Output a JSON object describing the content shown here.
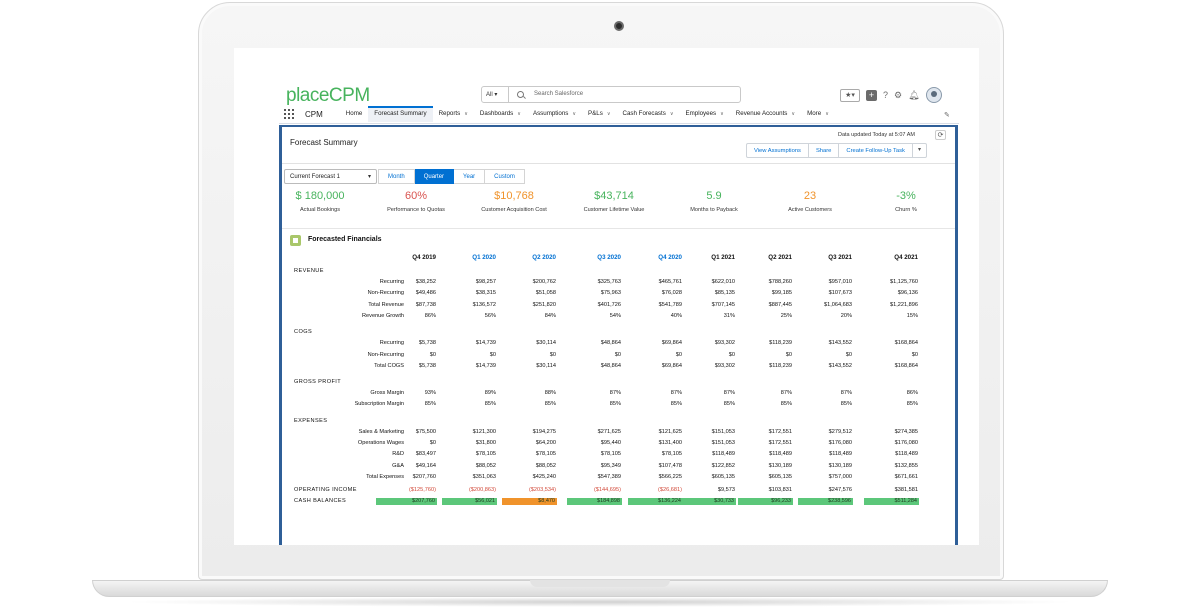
{
  "logo": {
    "text_main": "place",
    "text_suffix": "CPM"
  },
  "search": {
    "scope": "All",
    "placeholder": "Search Salesforce"
  },
  "nav": {
    "app_name": "CPM",
    "items": [
      {
        "label": "Home",
        "dropdown": false
      },
      {
        "label": "Forecast Summary",
        "dropdown": false,
        "active": true
      },
      {
        "label": "Reports",
        "dropdown": true
      },
      {
        "label": "Dashboards",
        "dropdown": true
      },
      {
        "label": "Assumptions",
        "dropdown": true
      },
      {
        "label": "P&Ls",
        "dropdown": true
      },
      {
        "label": "Cash Forecasts",
        "dropdown": true
      },
      {
        "label": "Employees",
        "dropdown": true
      },
      {
        "label": "Revenue Accounts",
        "dropdown": true
      },
      {
        "label": "More",
        "dropdown": true
      }
    ]
  },
  "page": {
    "title": "Forecast Summary",
    "updated": "Data updated Today at 5:07 AM",
    "buttons": [
      "View Assumptions",
      "Share",
      "Create Follow-Up Task"
    ]
  },
  "controls": {
    "forecast_select": "Current Forecast 1",
    "periods": [
      "Month",
      "Quarter",
      "Year",
      "Custom"
    ],
    "active_period": "Quarter"
  },
  "kpis": [
    {
      "value": "$ 180,000",
      "label": "Actual Bookings",
      "color": "#47b35d"
    },
    {
      "value": "60%",
      "label": "Performance to Quotas",
      "color": "#d9534f"
    },
    {
      "value": "$10,768",
      "label": "Customer Acquisition Cost",
      "color": "#f0932b"
    },
    {
      "value": "$43,714",
      "label": "Customer Lifetime Value",
      "color": "#47b35d"
    },
    {
      "value": "5.9",
      "label": "Months to Payback",
      "color": "#47b35d"
    },
    {
      "value": "23",
      "label": "Active Customers",
      "color": "#f0932b"
    },
    {
      "value": "-3%",
      "label": "Churn %",
      "color": "#47b35d"
    }
  ],
  "financials": {
    "title": "Forecasted Financials",
    "quarters": [
      {
        "label": "Q4 2019",
        "color": "#111111"
      },
      {
        "label": "Q1 2020",
        "color": "#0070d2"
      },
      {
        "label": "Q2 2020",
        "color": "#0070d2"
      },
      {
        "label": "Q3 2020",
        "color": "#0070d2"
      },
      {
        "label": "Q4 2020",
        "color": "#0070d2"
      },
      {
        "label": "Q1 2021",
        "color": "#111111"
      },
      {
        "label": "Q2 2021",
        "color": "#111111"
      },
      {
        "label": "Q3 2021",
        "color": "#111111"
      },
      {
        "label": "Q4 2021",
        "color": "#111111"
      }
    ],
    "sections": [
      {
        "name": "REVENUE",
        "rows": [
          {
            "label": "Recurring",
            "values": [
              "$38,252",
              "$98,257",
              "$200,762",
              "$325,763",
              "$465,761",
              "$622,010",
              "$788,260",
              "$957,010",
              "$1,125,760"
            ]
          },
          {
            "label": "Non-Recurring",
            "values": [
              "$49,486",
              "$38,315",
              "$51,058",
              "$75,963",
              "$76,028",
              "$85,135",
              "$99,185",
              "$107,673",
              "$96,136"
            ]
          },
          {
            "label": "Total Revenue",
            "values": [
              "$87,738",
              "$136,572",
              "$251,820",
              "$401,726",
              "$541,789",
              "$707,145",
              "$887,445",
              "$1,064,683",
              "$1,221,896"
            ]
          },
          {
            "label": "Revenue Growth",
            "values": [
              "86%",
              "56%",
              "84%",
              "54%",
              "40%",
              "31%",
              "25%",
              "20%",
              "15%"
            ]
          }
        ]
      },
      {
        "name": "COGS",
        "rows": [
          {
            "label": "Recurring",
            "values": [
              "$5,738",
              "$14,739",
              "$30,114",
              "$48,864",
              "$69,864",
              "$93,302",
              "$118,239",
              "$143,552",
              "$168,864"
            ]
          },
          {
            "label": "Non-Recurring",
            "values": [
              "$0",
              "$0",
              "$0",
              "$0",
              "$0",
              "$0",
              "$0",
              "$0",
              "$0"
            ]
          },
          {
            "label": "Total COGS",
            "values": [
              "$5,738",
              "$14,739",
              "$30,114",
              "$48,864",
              "$69,864",
              "$93,302",
              "$118,239",
              "$143,552",
              "$168,864"
            ]
          }
        ]
      },
      {
        "name": "GROSS PROFIT",
        "rows": [
          {
            "label": "Gross Margin",
            "values": [
              "93%",
              "89%",
              "88%",
              "87%",
              "87%",
              "87%",
              "87%",
              "87%",
              "86%"
            ]
          },
          {
            "label": "Subscription Margin",
            "values": [
              "85%",
              "85%",
              "85%",
              "85%",
              "85%",
              "85%",
              "85%",
              "85%",
              "85%"
            ]
          }
        ]
      },
      {
        "name": "EXPENSES",
        "rows": [
          {
            "label": "Sales & Marketing",
            "values": [
              "$75,500",
              "$121,300",
              "$194,275",
              "$271,625",
              "$121,625",
              "$151,053",
              "$172,551",
              "$279,512",
              "$274,385"
            ]
          },
          {
            "label": "Operations Wages",
            "values": [
              "$0",
              "$31,800",
              "$64,200",
              "$95,440",
              "$131,400",
              "$151,053",
              "$172,551",
              "$176,080",
              "$176,080"
            ]
          },
          {
            "label": "R&D",
            "values": [
              "$83,497",
              "$78,105",
              "$78,105",
              "$78,105",
              "$78,105",
              "$118,489",
              "$118,489",
              "$118,489",
              "$118,489"
            ]
          },
          {
            "label": "G&A",
            "values": [
              "$49,164",
              "$88,052",
              "$88,052",
              "$95,349",
              "$107,478",
              "$122,852",
              "$130,189",
              "$130,189",
              "$132,855"
            ]
          },
          {
            "label": "Total Expenses",
            "values": [
              "$207,760",
              "$351,063",
              "$425,240",
              "$547,389",
              "$566,225",
              "$605,135",
              "$605,135",
              "$757,000",
              "$671,661"
            ]
          }
        ]
      }
    ],
    "operating_income": {
      "label": "OPERATING INCOME",
      "values": [
        "($125,760)",
        "($200,863)",
        "($203,534)",
        "($144,695)",
        "($26,681)",
        "$9,573",
        "$103,831",
        "$247,576",
        "$381,581"
      ]
    },
    "cash_balances": {
      "label": "CASH BALANCES",
      "values": [
        "$207,760",
        "$56,021",
        "$8,470",
        "$184,898",
        "$136,224",
        "$30,733",
        "$96,233",
        "$238,596",
        "$511,284"
      ],
      "colors": [
        "#5cc77a",
        "#5cc77a",
        "#f0932b",
        "#5cc77a",
        "#5cc77a",
        "#5cc77a",
        "#5cc77a",
        "#5cc77a",
        "#5cc77a"
      ]
    }
  }
}
